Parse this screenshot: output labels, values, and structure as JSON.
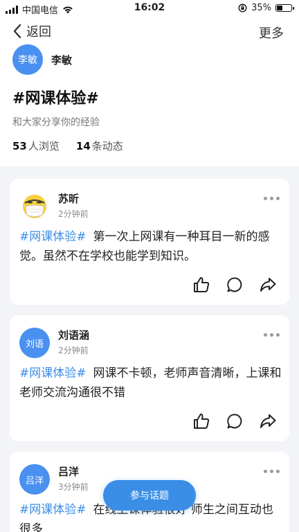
{
  "status_bar": {
    "carrier": "中国电信",
    "time": "16:02",
    "battery": "35%",
    "battery_level": 0.35
  },
  "nav": {
    "back_label": "返回",
    "more_label": "更多"
  },
  "topic": {
    "author_avatar_text": "李敏",
    "author_name": "李敏",
    "title": "#网课体验#",
    "subtitle": "和大家分享你的经验",
    "views_count": "53",
    "views_label": "人浏览",
    "posts_count": "14",
    "posts_label": "条动态"
  },
  "posts": [
    {
      "name": "苏昕",
      "avatar_icon": "mask-face-emoji-icon",
      "time": "2分钟前",
      "hashtag": "#网课体验#",
      "text": "第一次上网课有一种耳目一新的感觉。虽然不在学校也能学到知识。"
    },
    {
      "name": "刘语涵",
      "avatar_text": "刘语",
      "time": "2分钟前",
      "hashtag": "#网课体验#",
      "text": "网课不卡顿，老师声音清晰，上课和老师交流沟通很不错"
    },
    {
      "name": "吕洋",
      "avatar_text": "吕洋",
      "time": "3分钟前",
      "hashtag": "#网课体验#",
      "text": "在线上课体验很好 师生之间互动也很多"
    }
  ],
  "join_button_label": "参与话题",
  "colors": {
    "accent": "#3a8ee6",
    "avatar_blue": "#4a90f0",
    "page_bg": "#f3f4f7"
  }
}
